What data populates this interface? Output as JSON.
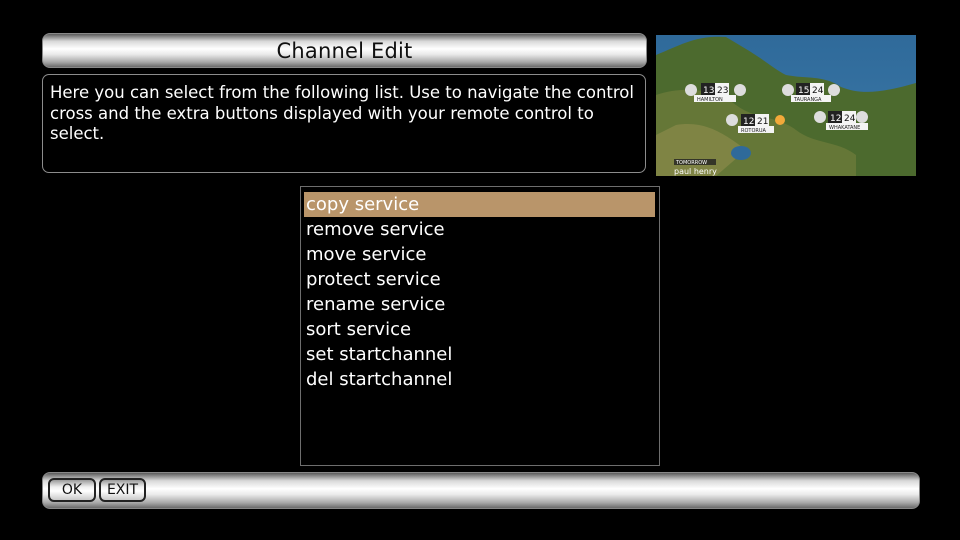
{
  "header": {
    "title": "Channel Edit"
  },
  "info": {
    "text": "Here you can select from the following list. Use to navigate the control cross and the extra buttons displayed with your remote control to select."
  },
  "preview": {
    "cities": [
      {
        "name": "HAMILTON",
        "low": "13",
        "high": "23"
      },
      {
        "name": "TAURANGA",
        "low": "15",
        "high": "24"
      },
      {
        "name": "ROTORUA",
        "low": "12",
        "high": "21"
      },
      {
        "name": "WHAKATANE",
        "low": "12",
        "high": "24"
      }
    ],
    "tag": "TOMORROW",
    "presenter": "paul henry"
  },
  "menu": {
    "selected_index": 0,
    "items": [
      "copy service",
      "remove service",
      "move service",
      "protect service",
      "rename service",
      "sort service",
      "set startchannel",
      "del startchannel"
    ]
  },
  "footer": {
    "ok_label": "OK",
    "exit_label": "EXIT"
  },
  "colors": {
    "selection": "#b9956a",
    "background": "#000000"
  }
}
